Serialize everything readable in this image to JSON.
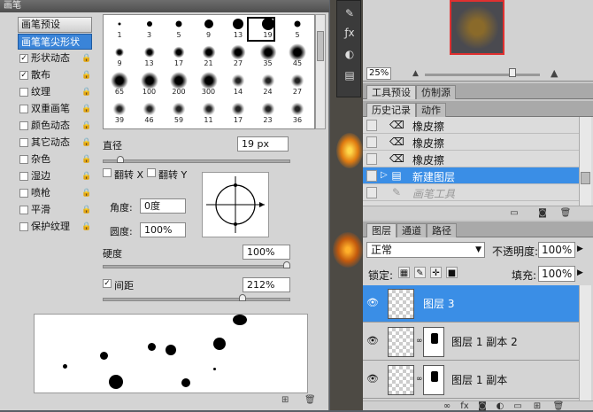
{
  "brush_panel": {
    "title": "画笔",
    "close": "×",
    "preset_button": "画笔预设",
    "options": [
      {
        "label": "画笔笔尖形状",
        "checked": false,
        "lock": false,
        "selected": true
      },
      {
        "label": "形状动态",
        "checked": true,
        "lock": true
      },
      {
        "label": "散布",
        "checked": true,
        "lock": true
      },
      {
        "label": "纹理",
        "checked": false,
        "lock": true
      },
      {
        "label": "双重画笔",
        "checked": false,
        "lock": true
      },
      {
        "label": "颜色动态",
        "checked": false,
        "lock": true
      },
      {
        "label": "其它动态",
        "checked": false,
        "lock": true
      },
      {
        "label": "杂色",
        "checked": false,
        "lock": true
      },
      {
        "label": "湿边",
        "checked": false,
        "lock": true
      },
      {
        "label": "喷枪",
        "checked": false,
        "lock": true
      },
      {
        "label": "平滑",
        "checked": false,
        "lock": true
      },
      {
        "label": "保护纹理",
        "checked": false,
        "lock": true
      }
    ],
    "brush_tips": [
      {
        "size": "1",
        "kind": "hard"
      },
      {
        "size": "3",
        "kind": "hard"
      },
      {
        "size": "5",
        "kind": "hard"
      },
      {
        "size": "9",
        "kind": "hard"
      },
      {
        "size": "13",
        "kind": "hard"
      },
      {
        "size": "19",
        "kind": "hard",
        "selected": true
      },
      {
        "size": "5",
        "kind": "hard"
      },
      {
        "size": "9",
        "kind": "soft"
      },
      {
        "size": "13",
        "kind": "soft"
      },
      {
        "size": "17",
        "kind": "soft"
      },
      {
        "size": "21",
        "kind": "soft"
      },
      {
        "size": "27",
        "kind": "soft"
      },
      {
        "size": "35",
        "kind": "soft"
      },
      {
        "size": "45",
        "kind": "soft"
      },
      {
        "size": "65",
        "kind": "soft"
      },
      {
        "size": "100",
        "kind": "soft"
      },
      {
        "size": "200",
        "kind": "soft"
      },
      {
        "size": "300",
        "kind": "soft"
      },
      {
        "size": "14",
        "kind": "texture"
      },
      {
        "size": "24",
        "kind": "texture"
      },
      {
        "size": "27",
        "kind": "texture"
      },
      {
        "size": "39",
        "kind": "texture"
      },
      {
        "size": "46",
        "kind": "texture"
      },
      {
        "size": "59",
        "kind": "texture"
      },
      {
        "size": "11",
        "kind": "texture"
      },
      {
        "size": "17",
        "kind": "texture"
      },
      {
        "size": "23",
        "kind": "texture"
      },
      {
        "size": "36",
        "kind": "texture"
      }
    ],
    "diameter_label": "直径",
    "diameter_value": "19 px",
    "flip_x": "翻转 X",
    "flip_y": "翻转 Y",
    "angle_label": "角度:",
    "angle_value": "0度",
    "roundness_label": "圆度:",
    "roundness_value": "100%",
    "hardness_label": "硬度",
    "hardness_value": "100%",
    "spacing_label": "间距",
    "spacing_checked": true,
    "spacing_value": "212%",
    "footer_icon_a": "new-preset-icon",
    "footer_icon_b": "trash-icon"
  },
  "navigator": {
    "zoom": "25%"
  },
  "tool_presets_tabs": [
    "工具预设",
    "仿制源"
  ],
  "history": {
    "tabs": [
      "历史记录",
      "动作"
    ],
    "items": [
      {
        "label": "橡皮擦",
        "icon": "eraser-icon"
      },
      {
        "label": "橡皮擦",
        "icon": "eraser-icon"
      },
      {
        "label": "橡皮擦",
        "icon": "eraser-icon"
      },
      {
        "label": "新建图层",
        "icon": "new-layer-icon",
        "selected": true
      },
      {
        "label": "画笔工具",
        "icon": "brush-icon",
        "dim": true
      }
    ]
  },
  "layers": {
    "tabs": [
      "图层",
      "通道",
      "路径"
    ],
    "blend_mode": "正常",
    "opacity_label": "不透明度:",
    "opacity_value": "100%",
    "lock_label": "锁定:",
    "fill_label": "填充:",
    "fill_value": "100%",
    "items": [
      {
        "name": "图层 3",
        "selected": true,
        "has_mask": false
      },
      {
        "name": "图层 1 副本 2",
        "selected": false,
        "has_mask": true
      },
      {
        "name": "图层 1 副本",
        "selected": false,
        "has_mask": true
      }
    ]
  }
}
